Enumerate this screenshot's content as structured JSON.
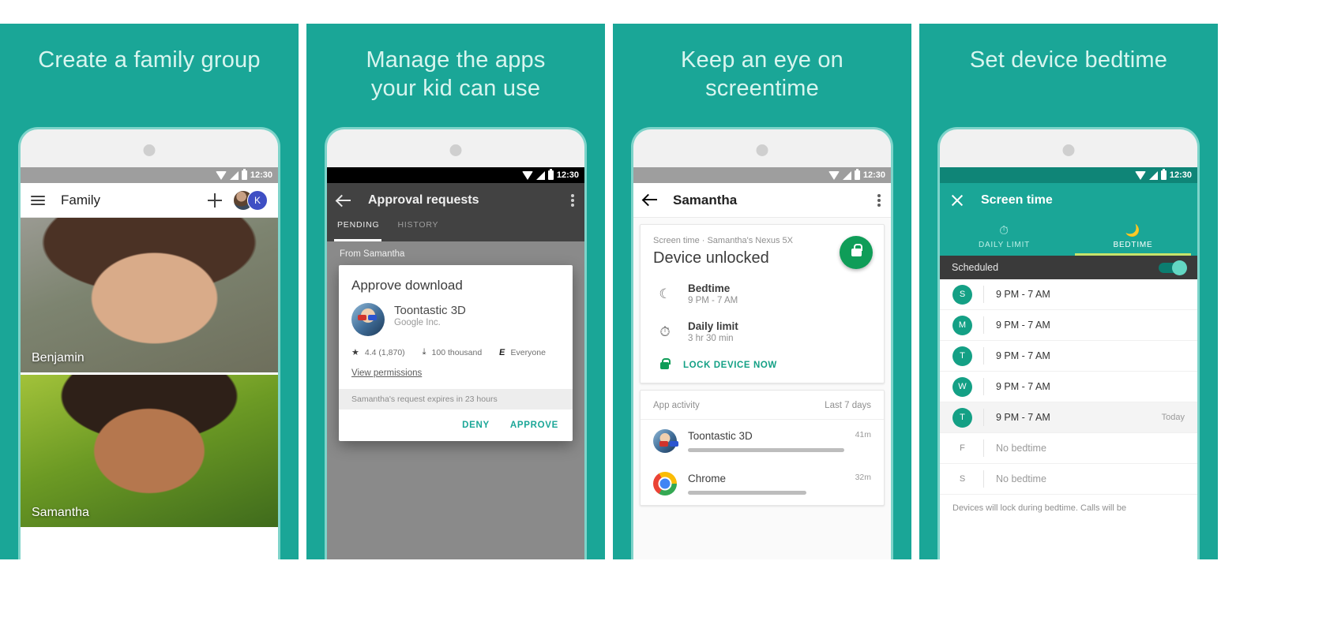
{
  "theme": {
    "brand_teal": "#1aa697",
    "title_text": "#d8f5ef",
    "green_accent": "#0f9d58",
    "lime_underline": "#c6e36b"
  },
  "panels": [
    {
      "id": "family-group",
      "title": "Create a family group",
      "statusbar": {
        "time": "12:30",
        "style": "grey"
      },
      "appbar": {
        "menu_icon": "hamburger-icon",
        "title": "Family",
        "add_icon": "plus-icon",
        "avatar_initial": "K"
      },
      "members": [
        {
          "name": "Benjamin"
        },
        {
          "name": "Samantha"
        }
      ]
    },
    {
      "id": "approval-requests",
      "title": "Manage the apps\nyour kid can use",
      "statusbar": {
        "time": "12:30",
        "style": "black"
      },
      "appbar": {
        "back_icon": "back-arrow-icon",
        "title": "Approval requests",
        "overflow_icon": "kebab-menu-icon"
      },
      "tabs": [
        {
          "label": "PENDING",
          "active": true
        },
        {
          "label": "HISTORY",
          "active": false
        }
      ],
      "from_label": "From Samantha",
      "dialog": {
        "title": "Approve download",
        "app_name": "Toontastic 3D",
        "app_developer": "Google Inc.",
        "rating": "4.4 (1,870)",
        "downloads": "100 thousand",
        "content_rating": "Everyone",
        "content_rating_badge": "E",
        "permissions_link": "View permissions",
        "expiry_note": "Samantha's request expires in 23 hours",
        "deny_label": "DENY",
        "approve_label": "APPROVE"
      }
    },
    {
      "id": "screen-time",
      "title": "Keep an eye on\nscreentime",
      "statusbar": {
        "time": "12:30",
        "style": "grey"
      },
      "appbar": {
        "back_icon": "back-arrow-icon",
        "title": "Samantha",
        "overflow_icon": "kebab-menu-icon"
      },
      "screen_time_card": {
        "subtitle": "Screen time · Samantha's Nexus 5X",
        "heading": "Device unlocked",
        "lock_fab_icon": "lock-icon",
        "rows": [
          {
            "icon": "moon-icon",
            "label": "Bedtime",
            "value": "9 PM - 7 AM"
          },
          {
            "icon": "stopwatch-icon",
            "label": "Daily limit",
            "value": "3 hr 30 min"
          }
        ],
        "lock_action": "LOCK DEVICE NOW"
      },
      "app_activity": {
        "title": "App activity",
        "range": "Last 7 days",
        "apps": [
          {
            "name": "Toontastic 3D",
            "time": "41m",
            "bar_pct": 100,
            "icon": "toontastic-icon"
          },
          {
            "name": "Chrome",
            "time": "32m",
            "bar_pct": 76,
            "icon": "chrome-icon"
          }
        ]
      }
    },
    {
      "id": "device-bedtime",
      "title": "Set device bedtime",
      "statusbar": {
        "time": "12:30",
        "style": "teal"
      },
      "appbar": {
        "close_icon": "close-x-icon",
        "title": "Screen time"
      },
      "tabs": [
        {
          "label": "DAILY LIMIT",
          "icon": "stopwatch-icon",
          "glyph": "⏱",
          "active": false
        },
        {
          "label": "BEDTIME",
          "icon": "moon-icon",
          "glyph": "🌙",
          "active": true
        }
      ],
      "scheduled_label": "Scheduled",
      "scheduled_on": true,
      "days": [
        {
          "letter": "S",
          "time": "9 PM - 7 AM",
          "enabled": true,
          "today": false,
          "today_label": ""
        },
        {
          "letter": "M",
          "time": "9 PM - 7 AM",
          "enabled": true,
          "today": false,
          "today_label": ""
        },
        {
          "letter": "T",
          "time": "9 PM - 7 AM",
          "enabled": true,
          "today": false,
          "today_label": ""
        },
        {
          "letter": "W",
          "time": "9 PM - 7 AM",
          "enabled": true,
          "today": false,
          "today_label": ""
        },
        {
          "letter": "T",
          "time": "9 PM - 7 AM",
          "enabled": true,
          "today": true,
          "today_label": "Today"
        },
        {
          "letter": "F",
          "time": "No bedtime",
          "enabled": false,
          "today": false,
          "today_label": ""
        },
        {
          "letter": "S",
          "time": "No bedtime",
          "enabled": false,
          "today": false,
          "today_label": ""
        }
      ],
      "note": "Devices will lock during bedtime. Calls will be"
    }
  ]
}
